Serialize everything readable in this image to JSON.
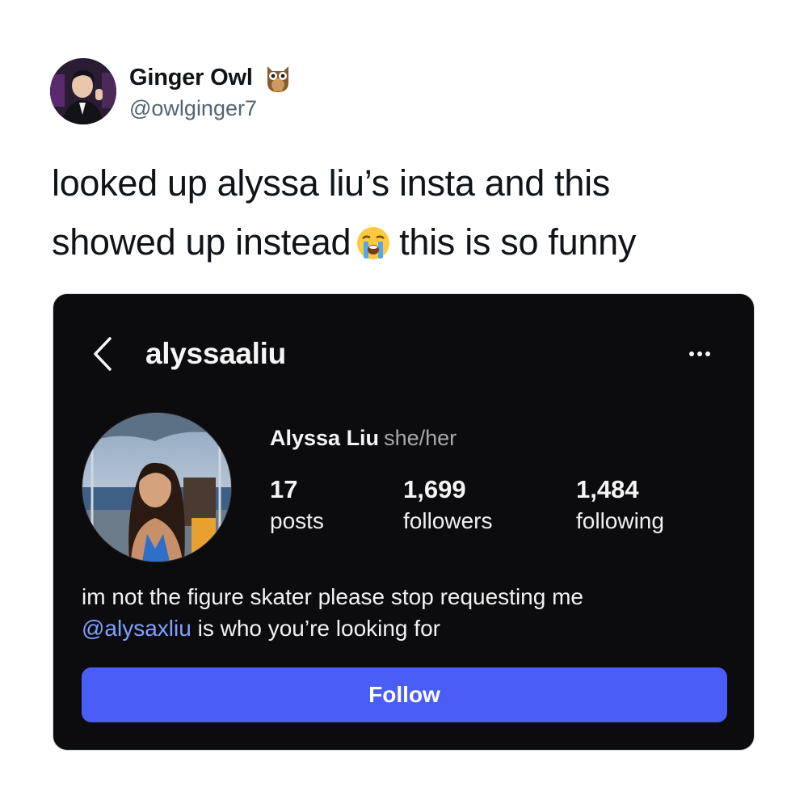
{
  "tweet": {
    "author_name": "Ginger Owl",
    "author_handle": "@owlginger7",
    "author_emoji_icon": "owl-icon",
    "text_line1": "looked up alyssa liu’s insta and this",
    "text_line2_a": "showed up instead",
    "text_line2_emoji_icon": "loudly-crying-face-icon",
    "text_line2_b": "this is so funny"
  },
  "embedded_profile": {
    "username": "alyssaaliu",
    "display_name": "Alyssa Liu",
    "pronouns": "she/her",
    "stats": [
      {
        "value": "17",
        "label": "posts"
      },
      {
        "value": "1,699",
        "label": "followers"
      },
      {
        "value": "1,484",
        "label": "following"
      }
    ],
    "bio_line1": "im not the figure skater please stop requesting me",
    "bio_mention": "@alysaxliu",
    "bio_line2_rest": " is who you’re looking for",
    "follow_label": "Follow"
  },
  "colors": {
    "card_background": "#0c0c0f",
    "follow_button": "#4a5df7",
    "mention": "#7fa1ff",
    "handle_gray": "#536471"
  }
}
